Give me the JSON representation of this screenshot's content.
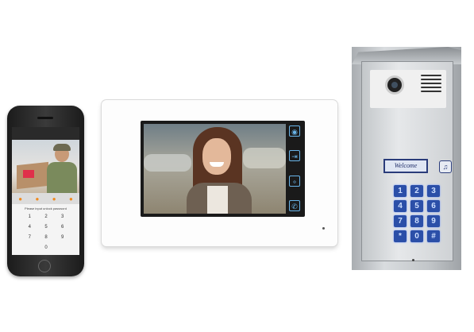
{
  "phone": {
    "prompt": "Please input unlock password",
    "keys": [
      "1",
      "2",
      "3",
      "4",
      "5",
      "6",
      "7",
      "8",
      "9",
      "0"
    ]
  },
  "monitor": {
    "side_icons": [
      "eye-icon",
      "door-open-icon",
      "key-icon",
      "handset-icon"
    ]
  },
  "door_station": {
    "name_plate": "Welcome",
    "keypad": [
      "1",
      "2",
      "3",
      "4",
      "5",
      "6",
      "7",
      "8",
      "9",
      "*",
      "0",
      "#"
    ]
  }
}
